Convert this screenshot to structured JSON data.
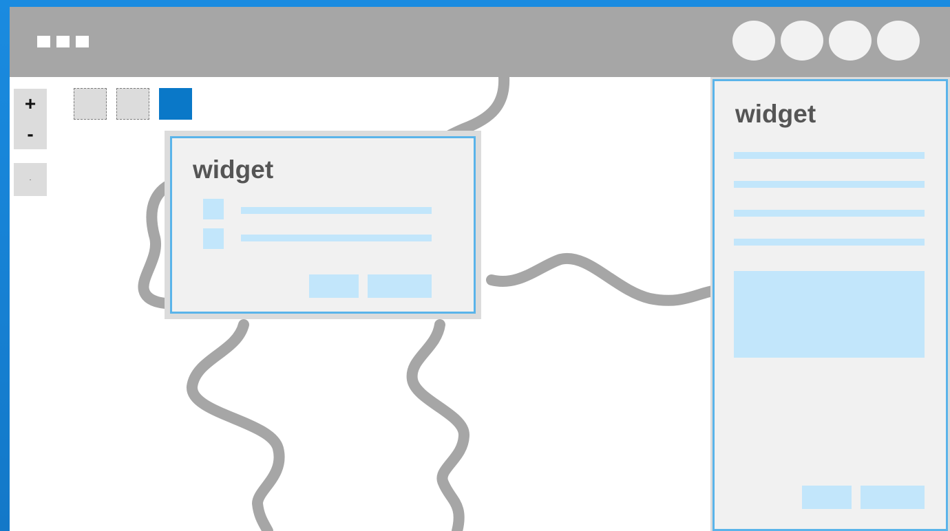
{
  "header": {
    "menu_icon": "three-squares-menu-icon",
    "action_circles": [
      "circle-action-1",
      "circle-action-2",
      "circle-action-3",
      "circle-action-4"
    ]
  },
  "map_controls": {
    "zoom_in_label": "+",
    "zoom_out_label": "-",
    "home_label": "·"
  },
  "basemaps": [
    {
      "name": "basemap-1",
      "active": false
    },
    {
      "name": "basemap-2",
      "active": false
    },
    {
      "name": "basemap-3",
      "active": true
    }
  ],
  "floating_widget": {
    "title": "widget"
  },
  "side_widget": {
    "title": "widget"
  },
  "colors": {
    "accent": "#0a78c8",
    "widget_border": "#5ab4ea",
    "placeholder": "#c2e6fb",
    "header": "#a6a6a6",
    "river": "#a6a6a6"
  }
}
